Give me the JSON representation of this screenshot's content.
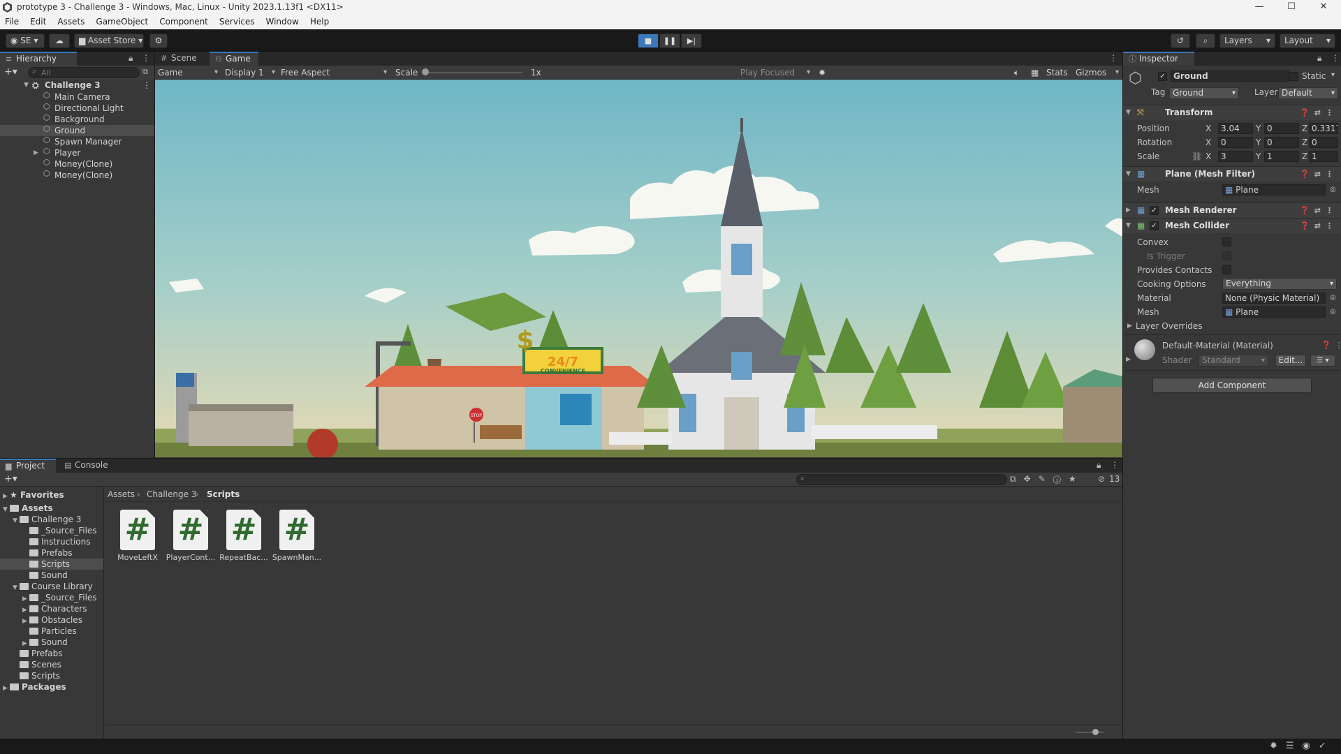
{
  "window": {
    "title": "prototype 3 - Challenge 3 - Windows, Mac, Linux - Unity 2023.1.13f1 <DX11>",
    "minimize": "—",
    "maximize": "☐",
    "close": "✕"
  },
  "menu": [
    "File",
    "Edit",
    "Assets",
    "GameObject",
    "Component",
    "Services",
    "Window",
    "Help"
  ],
  "toolbar": {
    "account": "SE",
    "asset_store": "Asset Store",
    "layers": "Layers",
    "layout": "Layout"
  },
  "hierarchy": {
    "tab": "Hierarchy",
    "search_placeholder": "All",
    "scene": "Challenge 3",
    "items": [
      {
        "label": "Main Camera"
      },
      {
        "label": "Directional Light"
      },
      {
        "label": "Background"
      },
      {
        "label": "Ground",
        "selected": true
      },
      {
        "label": "Spawn Manager"
      },
      {
        "label": "Player",
        "expandable": true
      },
      {
        "label": "Money(Clone)"
      },
      {
        "label": "Money(Clone)"
      }
    ]
  },
  "gameview": {
    "tabs": [
      "Scene",
      "Game"
    ],
    "active_tab": "Game",
    "mode": "Game",
    "display": "Display 1",
    "aspect": "Free Aspect",
    "scale_label": "Scale",
    "scale_value": "1x",
    "play_focused": "Play Focused",
    "stats": "Stats",
    "gizmos": "Gizmos",
    "store_sign": "24/7",
    "store_sub": "CONVENIENCE",
    "stop_sign": "STOP"
  },
  "inspector": {
    "tab": "Inspector",
    "object_name": "Ground",
    "static_label": "Static",
    "tag_label": "Tag",
    "tag_value": "Ground",
    "layer_label": "Layer",
    "layer_value": "Default",
    "transform": {
      "title": "Transform",
      "position_label": "Position",
      "position": {
        "x": "3.04",
        "y": "0",
        "z": "0.3317"
      },
      "rotation_label": "Rotation",
      "rotation": {
        "x": "0",
        "y": "0",
        "z": "0"
      },
      "scale_label": "Scale",
      "scale": {
        "x": "3",
        "y": "1",
        "z": "1"
      }
    },
    "mesh_filter": {
      "title": "Plane (Mesh Filter)",
      "mesh_label": "Mesh",
      "mesh_value": "Plane"
    },
    "mesh_renderer": {
      "title": "Mesh Renderer"
    },
    "mesh_collider": {
      "title": "Mesh Collider",
      "convex_label": "Convex",
      "is_trigger_label": "Is Trigger",
      "provides_contacts_label": "Provides Contacts",
      "cooking_label": "Cooking Options",
      "cooking_value": "Everything",
      "material_label": "Material",
      "material_value": "None (Physic Material)",
      "mesh_label": "Mesh",
      "mesh_value": "Plane"
    },
    "layer_overrides": "Layer Overrides",
    "material": {
      "title": "Default-Material (Material)",
      "shader_label": "Shader",
      "shader_value": "Standard",
      "edit_label": "Edit..."
    },
    "add_component": "Add Component"
  },
  "project": {
    "tabs": [
      "Project",
      "Console"
    ],
    "hidden_count": "13",
    "breadcrumb": [
      "Assets",
      "Challenge 3",
      "Scripts"
    ],
    "favorites": "Favorites",
    "tree": [
      {
        "label": "Assets",
        "depth": 0,
        "bold": true,
        "arrow": "▼"
      },
      {
        "label": "Challenge 3",
        "depth": 1,
        "arrow": "▼"
      },
      {
        "label": "_Source_Files",
        "depth": 2,
        "arrow": ""
      },
      {
        "label": "Instructions",
        "depth": 2,
        "arrow": ""
      },
      {
        "label": "Prefabs",
        "depth": 2,
        "arrow": ""
      },
      {
        "label": "Scripts",
        "depth": 2,
        "arrow": "",
        "selected": true
      },
      {
        "label": "Sound",
        "depth": 2,
        "arrow": ""
      },
      {
        "label": "Course Library",
        "depth": 1,
        "arrow": "▼"
      },
      {
        "label": "_Source_Files",
        "depth": 2,
        "arrow": "▶"
      },
      {
        "label": "Characters",
        "depth": 2,
        "arrow": "▶"
      },
      {
        "label": "Obstacles",
        "depth": 2,
        "arrow": "▶"
      },
      {
        "label": "Particles",
        "depth": 2,
        "arrow": ""
      },
      {
        "label": "Sound",
        "depth": 2,
        "arrow": "▶"
      },
      {
        "label": "Prefabs",
        "depth": 1,
        "arrow": ""
      },
      {
        "label": "Scenes",
        "depth": 1,
        "arrow": ""
      },
      {
        "label": "Scripts",
        "depth": 1,
        "arrow": ""
      },
      {
        "label": "Packages",
        "depth": 0,
        "bold": true,
        "arrow": "▶"
      }
    ],
    "assets": [
      "MoveLeftX",
      "PlayerCont...",
      "RepeatBac...",
      "SpawnMan..."
    ],
    "asset_glyph": "#"
  }
}
